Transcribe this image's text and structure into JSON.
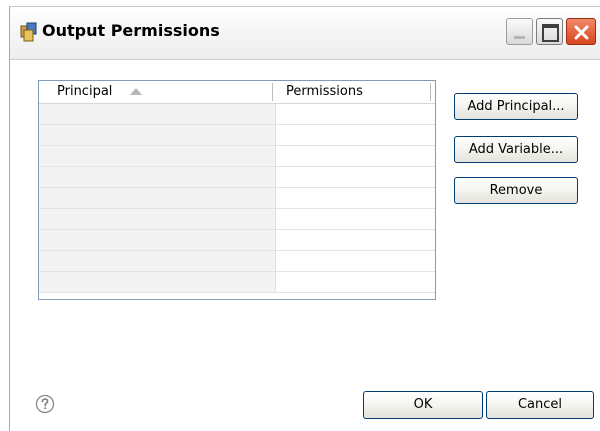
{
  "window": {
    "title": "Output Permissions",
    "icon": "permissions-app-icon",
    "controls": [
      "minimize-icon",
      "maximize-icon",
      "close-icon"
    ]
  },
  "table": {
    "columns": [
      {
        "label": "Principal",
        "sort": "ascending"
      },
      {
        "label": "Permissions"
      }
    ],
    "rows": [
      {
        "principal": "",
        "permissions": ""
      },
      {
        "principal": "",
        "permissions": ""
      },
      {
        "principal": "",
        "permissions": ""
      },
      {
        "principal": "",
        "permissions": ""
      },
      {
        "principal": "",
        "permissions": ""
      },
      {
        "principal": "",
        "permissions": ""
      },
      {
        "principal": "",
        "permissions": ""
      },
      {
        "principal": "",
        "permissions": ""
      },
      {
        "principal": "",
        "permissions": ""
      }
    ]
  },
  "actions": {
    "add_principal": "Add Principal...",
    "add_variable": "Add Variable...",
    "remove": "Remove"
  },
  "footer": {
    "help_icon": "help-icon",
    "ok": "OK",
    "cancel": "Cancel"
  },
  "colors": {
    "window_bg": "#ffffff",
    "button_border": "#003c74",
    "close_button": "#d9441e",
    "table_border": "#7f9db9",
    "principal_column_bg": "#f3f3f3"
  }
}
